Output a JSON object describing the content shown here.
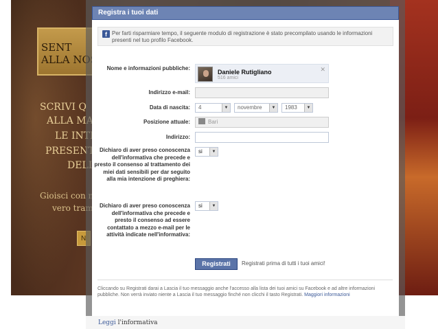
{
  "background": {
    "banner_lines": [
      "SENT",
      "ALLA NOS"
    ],
    "text_lines": [
      "SCRIVI Q",
      "ALLA MA",
      "LE INTE",
      "PRESENTA",
      "DELL"
    ],
    "small_lines": [
      "Gioisci con n",
      "vero tram"
    ],
    "button_label": "N"
  },
  "dialog": {
    "title": "Registra i tuoi dati",
    "intro_text": "Per farti risparmiare tempo, il seguente modulo di registrazione è stato precompilato usando le informazioni presenti nel tuo profilo Facebook.",
    "fields": {
      "name_label": "Nome e informazioni pubbliche:",
      "profile_name": "Daniele Rutigliano",
      "profile_friends": "516 amici",
      "email_label": "Indirizzo e-mail:",
      "email_value": "",
      "birth_label": "Data di nascita:",
      "birth_day": "4",
      "birth_month": "novembre",
      "birth_year": "1983",
      "position_label": "Posizione attuale:",
      "position_value": "Bari",
      "address_label": "Indirizzo:",
      "address_value": "",
      "consent1_label": "Dichiaro di aver preso conoscenza dell'informativa che precede e presto il consenso al trattamento dei miei dati sensibili per dar seguito alla mia intenzione di preghiera:",
      "consent1_value": "si",
      "consent2_label": "Dichiaro di aver preso conoscenza dell'informativa che precede e presto il consenso ad essere contattato a mezzo e-mail per le attività indicate nell'informativa:",
      "consent2_value": "si"
    },
    "register_button": "Registrati",
    "register_note": "Registrati prima di tutti i tuoi amici!",
    "footer_text": "Cliccando su Registrati darai a Lascia il tuo messaggio anche l'accesso alla lista dei tuoi amici su Facebook e ad altre informazioni pubbliche. Non verrà inviato niente a Lascia il tuo messaggio finché non clicchi il tasto Registrati.",
    "footer_link": "Maggiori informazioni"
  },
  "bottom": {
    "link_label": "Leggi",
    "text": "l'informativa"
  },
  "colors": {
    "facebook_blue": "#3b5998",
    "title_bar": "#6d84b4",
    "button": "#5b74a8"
  },
  "icons": [
    "facebook-icon",
    "close-icon",
    "chevron-down-icon",
    "location-icon"
  ]
}
